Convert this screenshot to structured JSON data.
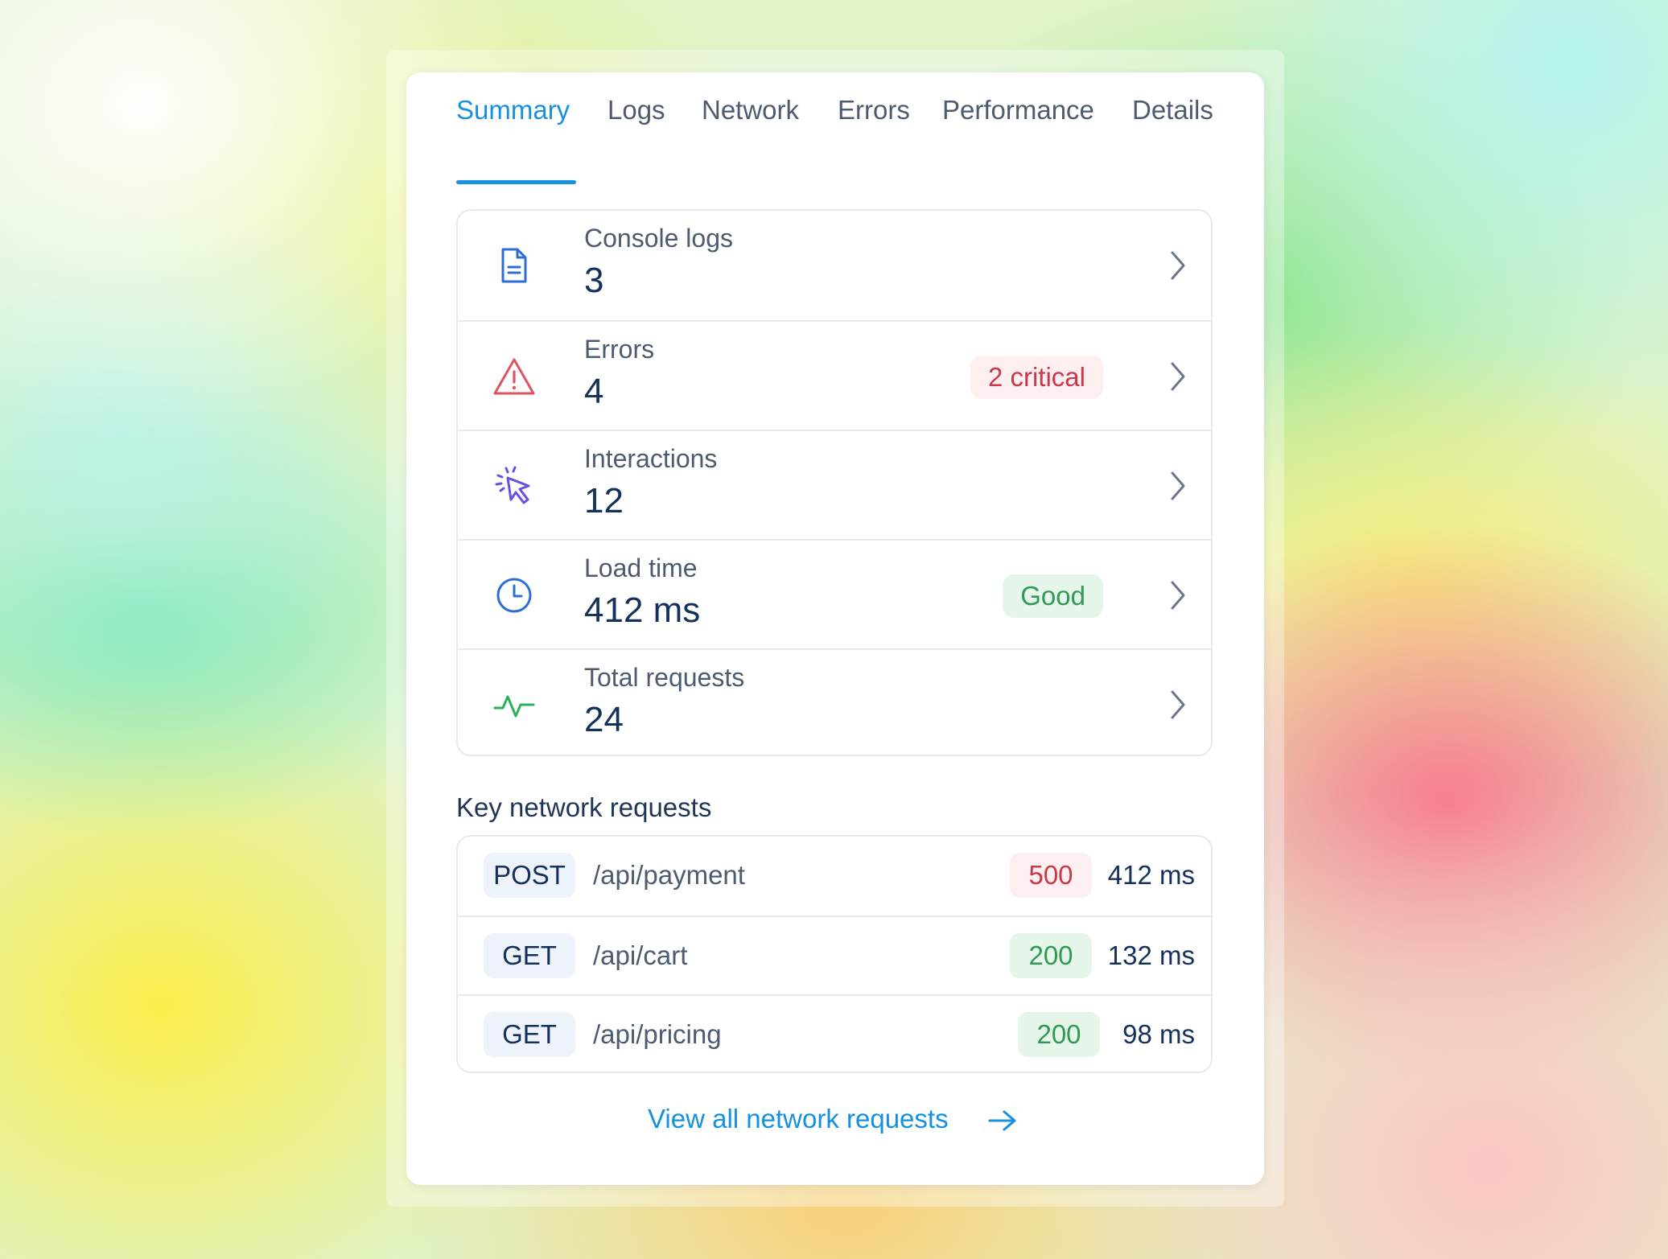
{
  "tabs": [
    {
      "label": "Summary",
      "active": true
    },
    {
      "label": "Logs"
    },
    {
      "label": "Network"
    },
    {
      "label": "Errors"
    },
    {
      "label": "Performance"
    },
    {
      "label": "Details"
    }
  ],
  "summary": {
    "rows": [
      {
        "label": "Console logs",
        "value": "3",
        "icon": "document-icon"
      },
      {
        "label": "Errors",
        "value": "4",
        "icon": "warning-icon",
        "badge": "2 critical"
      },
      {
        "label": "Interactions",
        "value": "12",
        "icon": "cursor-click-icon"
      },
      {
        "label": "Load time",
        "value": "412 ms",
        "icon": "clock-icon",
        "badge": "Good"
      },
      {
        "label": "Total requests",
        "value": "24",
        "icon": "activity-icon"
      }
    ]
  },
  "network": {
    "title": "Key network requests",
    "requests": [
      {
        "method": "POST",
        "path": "/api/payment",
        "status": "500",
        "duration": "412 ms"
      },
      {
        "method": "GET",
        "path": "/api/cart",
        "status": "200",
        "duration": "132 ms"
      },
      {
        "method": "GET",
        "path": "/api/pricing",
        "status": "200",
        "duration": "98 ms"
      }
    ],
    "view_all_label": "View all network requests"
  },
  "colors": {
    "accent": "#1690e0",
    "error": "#c83a4a",
    "success": "#2e9a54",
    "text_dark": "#14305c",
    "text_muted": "#4d5b70"
  }
}
